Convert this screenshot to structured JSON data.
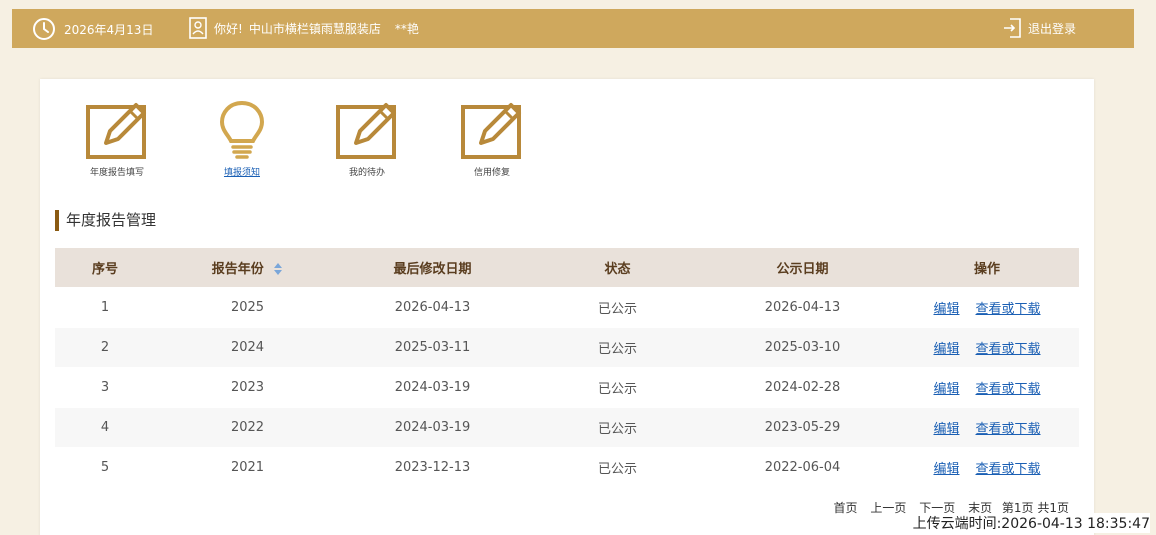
{
  "header": {
    "date": "2026年4月13日",
    "greeting": "你好!",
    "company": "中山市横栏镇雨慧服装店",
    "user": "**艳",
    "logout": "退出登录"
  },
  "quick_links": [
    {
      "label": "年度报告填写",
      "icon": "edit-icon"
    },
    {
      "label": "填报须知",
      "icon": "lightbulb-icon"
    },
    {
      "label": "我的待办",
      "icon": "edit-icon"
    },
    {
      "label": "信用修复",
      "icon": "edit-icon"
    }
  ],
  "section_title": "年度报告管理",
  "table": {
    "headers": [
      "序号",
      "报告年份",
      "最后修改日期",
      "状态",
      "公示日期",
      "操作"
    ],
    "rows": [
      {
        "no": "1",
        "year": "2025",
        "modified": "2026-04-13",
        "status": "已公示",
        "published": "2026-04-13"
      },
      {
        "no": "2",
        "year": "2024",
        "modified": "2025-03-11",
        "status": "已公示",
        "published": "2025-03-10"
      },
      {
        "no": "3",
        "year": "2023",
        "modified": "2024-03-19",
        "status": "已公示",
        "published": "2024-02-28"
      },
      {
        "no": "4",
        "year": "2022",
        "modified": "2024-03-19",
        "status": "已公示",
        "published": "2023-05-29"
      },
      {
        "no": "5",
        "year": "2021",
        "modified": "2023-12-13",
        "status": "已公示",
        "published": "2022-06-04"
      }
    ],
    "action_edit": "编辑",
    "action_view": "查看或下载"
  },
  "pager": {
    "first": "首页",
    "prev": "上一页",
    "next": "下一页",
    "last": "末页",
    "page_info": "第1页 共1页"
  },
  "upload_time": "上传云端时间:2026-04-13 18:35:47",
  "colors": {
    "header_bg": "#cfa85d",
    "accent": "#b8893a",
    "link": "#1a5fb4"
  }
}
